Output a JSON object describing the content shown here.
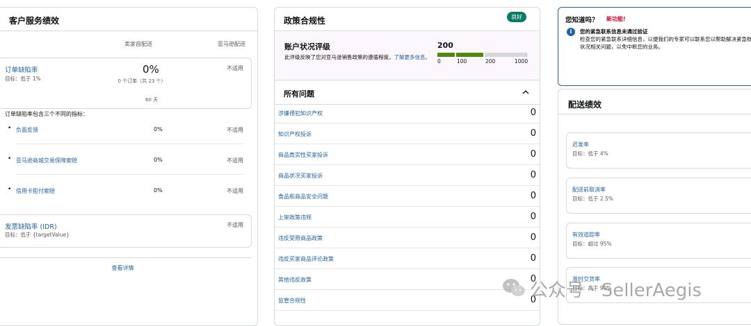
{
  "customer_service": {
    "title": "客户服务绩效",
    "col_seller": "卖家自配送",
    "col_amazon": "亚马逊配送",
    "odr": {
      "name": "订单缺陷率",
      "target": "目标：低于 1%",
      "value": "0%",
      "orders": "0 个订单（共 23 个）",
      "period": "60 天",
      "amazon": "不适用"
    },
    "intro": "订单缺陷率包含三个不同的指标：",
    "metrics": [
      {
        "label": "负面反馈",
        "value": "0%",
        "amazon": "不适用"
      },
      {
        "label": "亚马逊商城交易保障索赔",
        "value": "0%",
        "amazon": "不适用"
      },
      {
        "label": "信用卡拒付索赔",
        "value": "0%",
        "amazon": "不适用"
      }
    ],
    "idr": {
      "name": "发票缺陷率 (IDR)",
      "target": "目标：低于 {targetValue}",
      "amazon": "不适用"
    },
    "view_details": "查看详情"
  },
  "policy": {
    "title": "政策合规性",
    "badge": "良好",
    "health_title": "账户状况评级",
    "health_desc": "此评级反映了您对亚马逊销售政策的遵循程度。",
    "learn_more": "了解更多信息。",
    "score": "200",
    "score_value": 200,
    "ticks": [
      "0",
      "100",
      "200",
      "1000"
    ],
    "colors": {
      "good": "#4f8a10",
      "empty": "#d5d9d9"
    },
    "all_issues": "所有问题",
    "issues": [
      {
        "label": "涉嫌侵犯知识产权",
        "count": "0"
      },
      {
        "label": "知识产权投诉",
        "count": "0"
      },
      {
        "label": "商品真实性买家投诉",
        "count": "0"
      },
      {
        "label": "商品状况买家投诉",
        "count": "0"
      },
      {
        "label": "食品和商品安全问题",
        "count": "0"
      },
      {
        "label": "上架政策违规",
        "count": "0"
      },
      {
        "label": "违反受限商品政策",
        "count": "0"
      },
      {
        "label": "违反买家商品评论政策",
        "count": "0"
      },
      {
        "label": "其他违反政策",
        "count": "0"
      },
      {
        "label": "监管合规性",
        "count": "0"
      }
    ]
  },
  "did_you_know": {
    "title": "您知道吗？",
    "new": "新功能!",
    "headline": "您的紧急联系信息未通过验证",
    "desc": "检查您的紧急联系详细信息，以便我们的专家可以联系您以帮助解决紧急账户状况相关问题，以免中断您的业务。"
  },
  "shipping": {
    "title": "配送绩效",
    "metrics": [
      {
        "name": "迟发率",
        "target": "目标：低于 4%"
      },
      {
        "name": "配送前取消率",
        "target": "目标：低于 2.5%"
      },
      {
        "name": "有效追踪率",
        "target": "目标：超过 95%"
      },
      {
        "name": "准时交货率",
        "target": "目标：高于 90%"
      }
    ]
  },
  "watermark": {
    "text": "公众号 · SellerAegis"
  }
}
